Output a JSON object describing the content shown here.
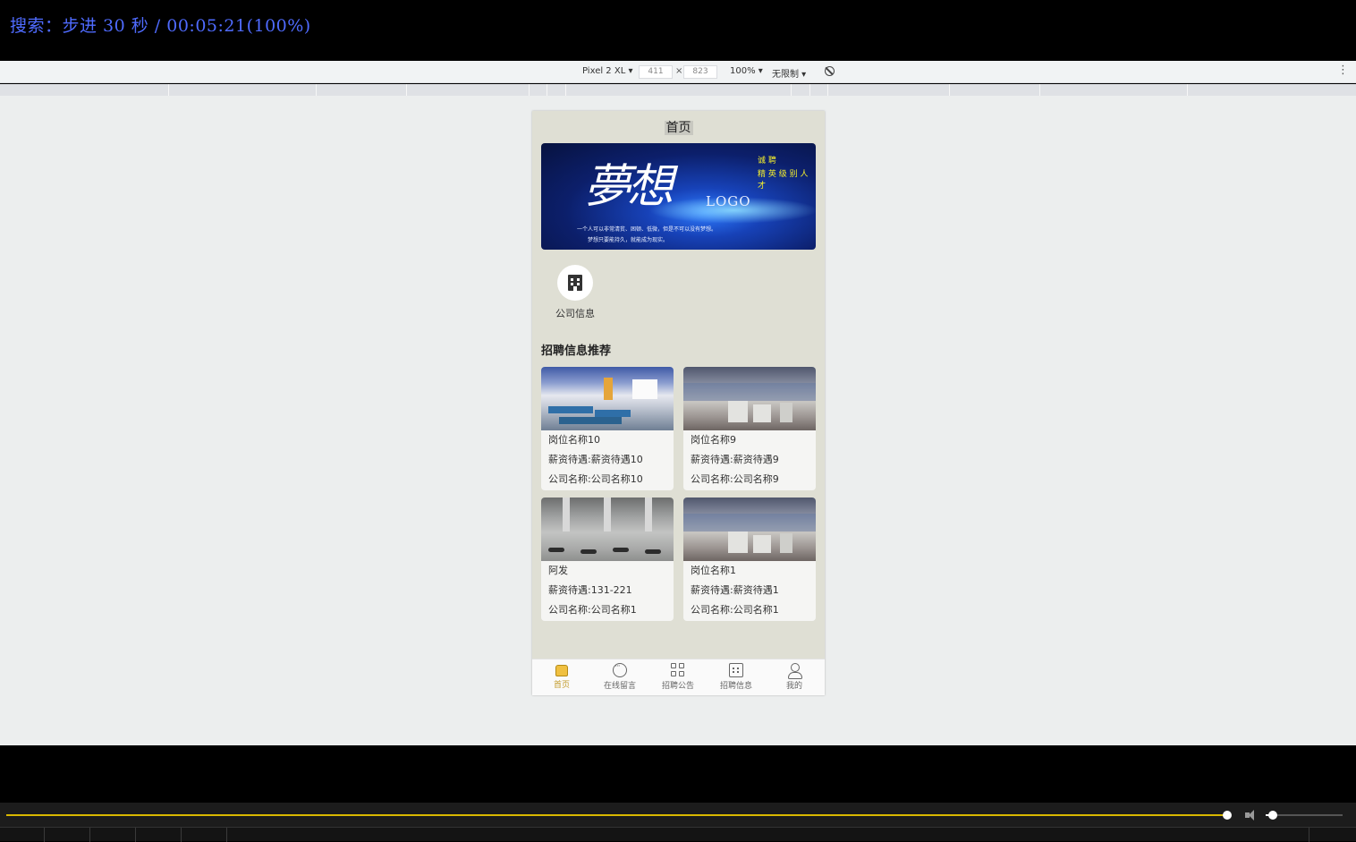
{
  "osd": {
    "text": "搜索：步进 30 秒 / 00:05:21(100%)"
  },
  "devtools": {
    "device": "Pixel 2 XL ▾",
    "width": "411",
    "separator": "×",
    "height": "823",
    "zoom": "100% ▾",
    "throttle": "无限制 ▾",
    "more": "⋮"
  },
  "app": {
    "title": "首页",
    "banner": {
      "main": "夢想",
      "logo": "LOGO",
      "yellow1": "诚 聘",
      "yellow2": "精 英 级 别 人 才",
      "small1": "一个人可以非常清贫、困顿、低微，但是不可以没有梦想。",
      "small2": "梦想只要能持久，就能成为现实。"
    },
    "categories": [
      {
        "label": "公司信息",
        "icon": "building-icon"
      }
    ],
    "section_title": "招聘信息推荐",
    "jobs": [
      {
        "title": "岗位名称10",
        "salary": "薪资待遇:薪资待遇10",
        "company": "公司名称:公司名称10"
      },
      {
        "title": "岗位名称9",
        "salary": "薪资待遇:薪资待遇9",
        "company": "公司名称:公司名称9"
      },
      {
        "title": "阿发",
        "salary": "薪资待遇:131-221",
        "company": "公司名称:公司名称1"
      },
      {
        "title": "岗位名称1",
        "salary": "薪资待遇:薪资待遇1",
        "company": "公司名称:公司名称1"
      }
    ],
    "tabs": [
      {
        "label": "首页",
        "icon": "home-icon",
        "active": true
      },
      {
        "label": "在线留言",
        "icon": "chat-icon",
        "active": false
      },
      {
        "label": "招聘公告",
        "icon": "grid-icon",
        "active": false
      },
      {
        "label": "招聘信息",
        "icon": "calendar-icon",
        "active": false
      },
      {
        "label": "我的",
        "icon": "user-icon",
        "active": false
      }
    ],
    "colors": {
      "active_tab": "#c39b2a",
      "page_bg": "#dfdfd4"
    }
  },
  "player": {
    "progress_fraction": 1.0,
    "volume_fraction": 0.09
  }
}
